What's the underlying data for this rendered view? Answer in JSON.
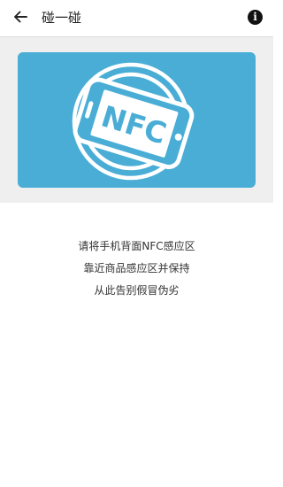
{
  "header": {
    "title": "碰一碰",
    "back_icon": "arrow-left-icon",
    "info_icon": "info-icon",
    "info_glyph": "i"
  },
  "illustration": {
    "icon": "nfc-phone-icon",
    "label": "NFC",
    "background_color": "#49add6"
  },
  "instructions": {
    "lines": [
      "请将手机背面NFC感应区",
      "靠近商品感应区并保持",
      "从此告别假冒伪劣"
    ]
  }
}
